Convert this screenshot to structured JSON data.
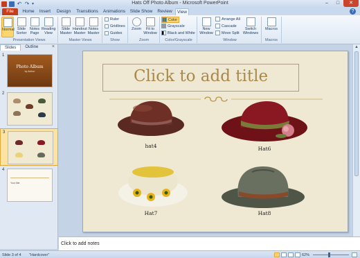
{
  "window": {
    "title": "Hats Off Photo Album - Microsoft PowerPoint",
    "controls": {
      "minimize": "–",
      "maximize": "□",
      "close": "✕"
    }
  },
  "qat": {
    "undo": "↶",
    "redo": "↷",
    "more": "▾"
  },
  "tabs": [
    {
      "label": "File"
    },
    {
      "label": "Home"
    },
    {
      "label": "Insert"
    },
    {
      "label": "Design"
    },
    {
      "label": "Transitions"
    },
    {
      "label": "Animations"
    },
    {
      "label": "Slide Show"
    },
    {
      "label": "Review"
    },
    {
      "label": "View"
    }
  ],
  "help": "?",
  "ribbon": {
    "presentation_views": {
      "label": "Presentation Views",
      "normal": "Normal",
      "slide_sorter": "Slide Sorter",
      "notes_page": "Notes Page",
      "reading_view": "Reading View"
    },
    "master_views": {
      "label": "Master Views",
      "slide_master": "Slide Master",
      "handout_master": "Handout Master",
      "notes_master": "Notes Master"
    },
    "show": {
      "label": "Show",
      "ruler": "Ruler",
      "gridlines": "Gridlines",
      "guides": "Guides"
    },
    "zoom": {
      "label": "Zoom",
      "zoom": "Zoom",
      "fit_to_window": "Fit to Window"
    },
    "color": {
      "label": "Color/Grayscale",
      "color": "Color",
      "grayscale": "Grayscale",
      "black_white": "Black and White"
    },
    "window": {
      "label": "Window",
      "new_window": "New Window",
      "arrange_all": "Arrange All",
      "cascade": "Cascade",
      "move_split": "Move Split",
      "switch_windows": "Switch Windows"
    },
    "macros": {
      "label": "Macros",
      "macros": "Macros"
    }
  },
  "panel": {
    "tabs": [
      "Slides",
      "Outline"
    ],
    "close": "×",
    "slides": [
      {
        "num": "1",
        "title": "Photo Album",
        "subtitle": "by Author"
      },
      {
        "num": "2"
      },
      {
        "num": "3"
      },
      {
        "num": "4",
        "title": "Your title"
      }
    ]
  },
  "slide": {
    "title_placeholder": "Click to add title",
    "hats": [
      {
        "caption": "hat4"
      },
      {
        "caption": "Hat6"
      },
      {
        "caption": "Hat7"
      },
      {
        "caption": "Hat8"
      }
    ]
  },
  "notes": {
    "placeholder": "Click to add notes"
  },
  "status": {
    "slide_info": "Slide 3 of 4",
    "theme": "\"Hardcover\"",
    "zoom": "62%"
  },
  "colors": {
    "file_tab": "#c43e1c",
    "active_highlight": "#fbd66f",
    "title_text": "#a9884a",
    "slide_bg": "#efe9d4"
  }
}
